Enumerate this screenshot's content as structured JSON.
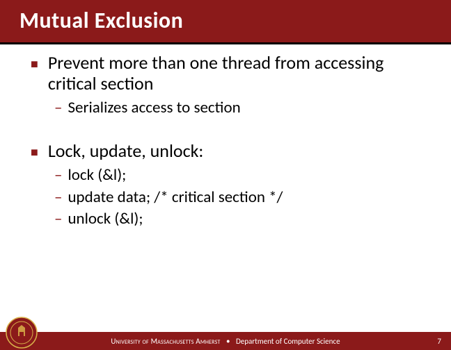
{
  "title": "Mutual Exclusion",
  "bullets": [
    {
      "text": "Prevent more than one thread from accessing critical section",
      "sub": [
        "Serializes access to section"
      ]
    },
    {
      "text": "Lock, update, unlock:",
      "sub": [
        "lock (&l);",
        "update data; /* critical section */",
        "unlock (&l);"
      ]
    }
  ],
  "footer": {
    "university": "University of Massachusetts Amherst",
    "department": "Department of Computer Science",
    "page": "7"
  }
}
